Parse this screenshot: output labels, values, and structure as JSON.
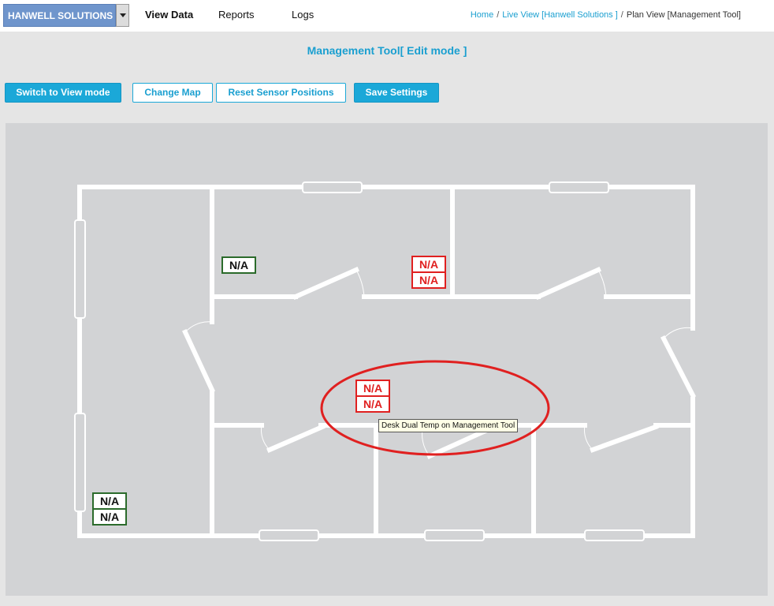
{
  "header": {
    "brand": "HANWELL SOLUTIONS",
    "nav": {
      "view_data": "View Data",
      "reports": "Reports",
      "logs": "Logs"
    },
    "breadcrumb": {
      "home": "Home",
      "live_view": "Live View [Hanwell Solutions ]",
      "current": "Plan View [Management Tool]",
      "separator": "/"
    }
  },
  "page": {
    "title": "Management Tool[ Edit mode ]"
  },
  "toolbar": {
    "switch_mode": "Switch to View mode",
    "change_map": "Change Map",
    "reset_positions": "Reset Sensor Positions",
    "save_settings": "Save Settings"
  },
  "sensors": [
    {
      "id": "sensor-top-left-room",
      "values": [
        "N/A"
      ],
      "status_color": "#2b6b2b"
    },
    {
      "id": "sensor-top-middle-room",
      "values": [
        "N/A",
        "N/A"
      ],
      "status_color": "#e02020"
    },
    {
      "id": "sensor-desk-dual-temp",
      "values": [
        "N/A",
        "N/A"
      ],
      "status_color": "#e02020"
    },
    {
      "id": "sensor-bottom-left",
      "values": [
        "N/A",
        "N/A"
      ],
      "status_color": "#2b6b2b"
    }
  ],
  "tooltip": {
    "text": "Desk Dual Temp on Management Tool"
  },
  "colors": {
    "accent": "#1ba8d8",
    "brand_bg": "#6f95cc",
    "alarm": "#e02020",
    "ok": "#2b6b2b",
    "highlight": "#e02020"
  }
}
